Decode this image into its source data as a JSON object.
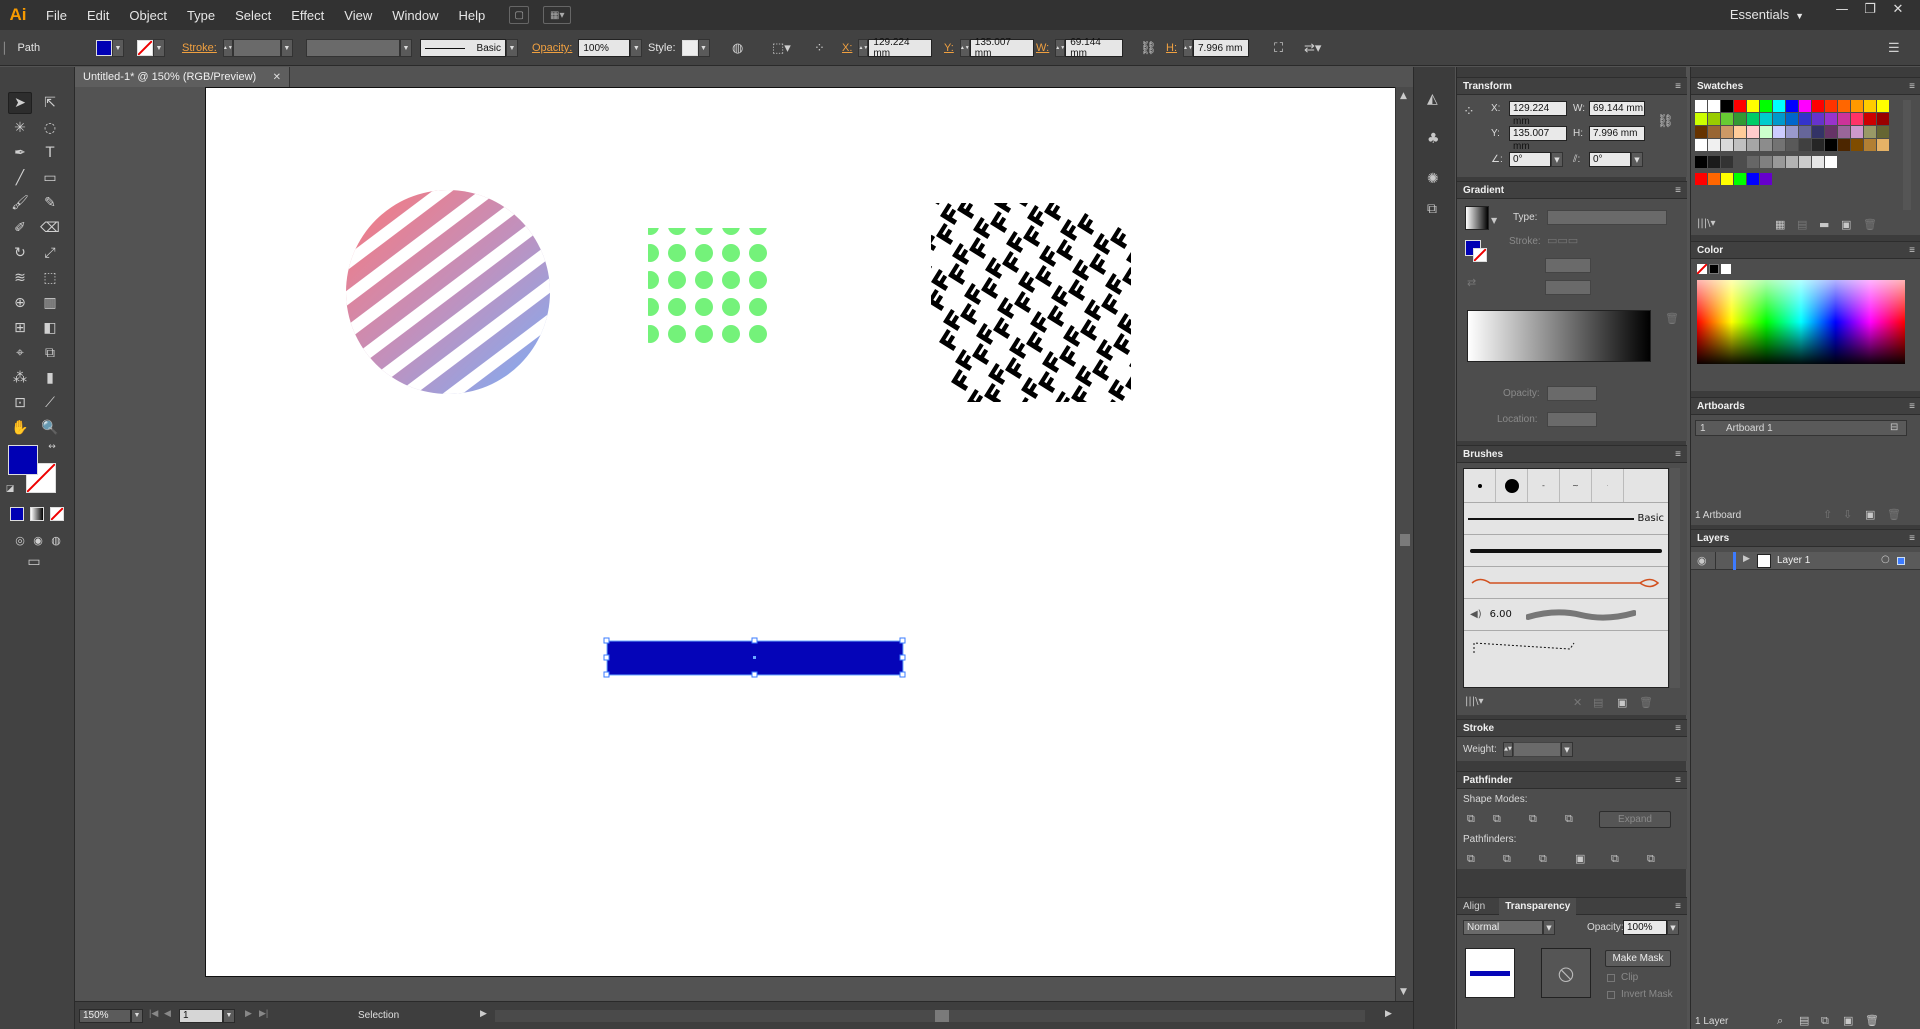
{
  "app": {
    "logo": "Ai",
    "workspace": "Essentials"
  },
  "menu": [
    "File",
    "Edit",
    "Object",
    "Type",
    "Select",
    "Effect",
    "View",
    "Window",
    "Help"
  ],
  "control_bar": {
    "object_type": "Path",
    "stroke_label": "Stroke:",
    "brush_label": "Basic",
    "opacity_label": "Opacity:",
    "opacity_value": "100%",
    "style_label": "Style:",
    "x_label": "X:",
    "x_value": "129.224 mm",
    "y_label": "Y:",
    "y_value": "135.007 mm",
    "w_label": "W:",
    "w_value": "69.144 mm",
    "h_label": "H:",
    "h_value": "7.996 mm",
    "fill_color": "#0000b4"
  },
  "document": {
    "tab_title": "Untitled-1* @ 150% (RGB/Preview)",
    "shapes": {
      "circle_colors": [
        "#ff7a7a",
        "#c08bbd",
        "#7ab4ff"
      ],
      "dot_color": "#74f27a",
      "rect_color": "#0505b8"
    }
  },
  "status": {
    "zoom": "150%",
    "page": "1",
    "tool": "Selection"
  },
  "transform": {
    "title": "Transform",
    "x_label": "X:",
    "x_value": "129.224 mm",
    "y_label": "Y:",
    "y_value": "135.007 mm",
    "w_label": "W:",
    "w_value": "69.144 mm",
    "h_label": "H:",
    "h_value": "7.996 mm",
    "rotate_value": "0°",
    "shear_value": "0°"
  },
  "gradient": {
    "title": "Gradient",
    "type_label": "Type:",
    "stroke_label": "Stroke:",
    "opacity_label": "Opacity:",
    "location_label": "Location:"
  },
  "brushes": {
    "title": "Brushes",
    "basic_label": "Basic",
    "size_value": "6.00"
  },
  "stroke": {
    "title": "Stroke",
    "weight_label": "Weight:"
  },
  "pathfinder": {
    "title": "Pathfinder",
    "shape_modes_label": "Shape Modes:",
    "expand_label": "Expand",
    "pathfinders_label": "Pathfinders:"
  },
  "transparency": {
    "align_tab": "Align",
    "title": "Transparency",
    "blend_mode": "Normal",
    "opacity_label": "Opacity:",
    "opacity_value": "100%",
    "make_mask_label": "Make Mask",
    "clip_label": "Clip",
    "invert_mask_label": "Invert Mask"
  },
  "swatches": {
    "title": "Swatches",
    "rows": [
      [
        "#ffffff",
        "#ffffff",
        "#000000",
        "#ff0000",
        "#ffff00",
        "#00ff00",
        "#00ffff",
        "#0000ff",
        "#ff00ff",
        "#ff0000",
        "#ff3300",
        "#ff6600",
        "#ff9900",
        "#ffcc00",
        "#ffff00"
      ],
      [
        "#ccff00",
        "#99cc00",
        "#66cc33",
        "#339933",
        "#00cc66",
        "#00cccc",
        "#0099cc",
        "#0066cc",
        "#3333cc",
        "#6633cc",
        "#9933cc",
        "#cc3399",
        "#ff3366",
        "#cc0000",
        "#990000"
      ],
      [
        "#663300",
        "#996633",
        "#cc9966",
        "#ffcc99",
        "#ffcccc",
        "#ccffcc",
        "#ccccff",
        "#9999cc",
        "#666699",
        "#333366",
        "#663366",
        "#996699",
        "#cc99cc",
        "#999966",
        "#666633"
      ],
      [
        "#ffffff",
        "#f0f0f0",
        "#d9d9d9",
        "#c0c0c0",
        "#a6a6a6",
        "#8c8c8c",
        "#737373",
        "#595959",
        "#404040",
        "#262626",
        "#000000",
        "#4c2600",
        "#7f4c00",
        "#b27f33",
        "#e5b266"
      ]
    ],
    "gray_row": [
      "#000000",
      "#1a1a1a",
      "#333333",
      "#4d4d4d",
      "#666666",
      "#808080",
      "#999999",
      "#b3b3b3",
      "#cccccc",
      "#e6e6e6",
      "#ffffff"
    ],
    "bright_row": [
      "#ff0000",
      "#ff6600",
      "#ffff00",
      "#00ff00",
      "#0000ff",
      "#6600cc"
    ]
  },
  "color": {
    "title": "Color"
  },
  "artboards": {
    "title": "Artboards",
    "items": [
      {
        "num": "1",
        "name": "Artboard 1"
      }
    ],
    "footer": "1 Artboard"
  },
  "layers": {
    "title": "Layers",
    "items": [
      {
        "name": "Layer 1"
      }
    ],
    "footer": "1 Layer"
  }
}
